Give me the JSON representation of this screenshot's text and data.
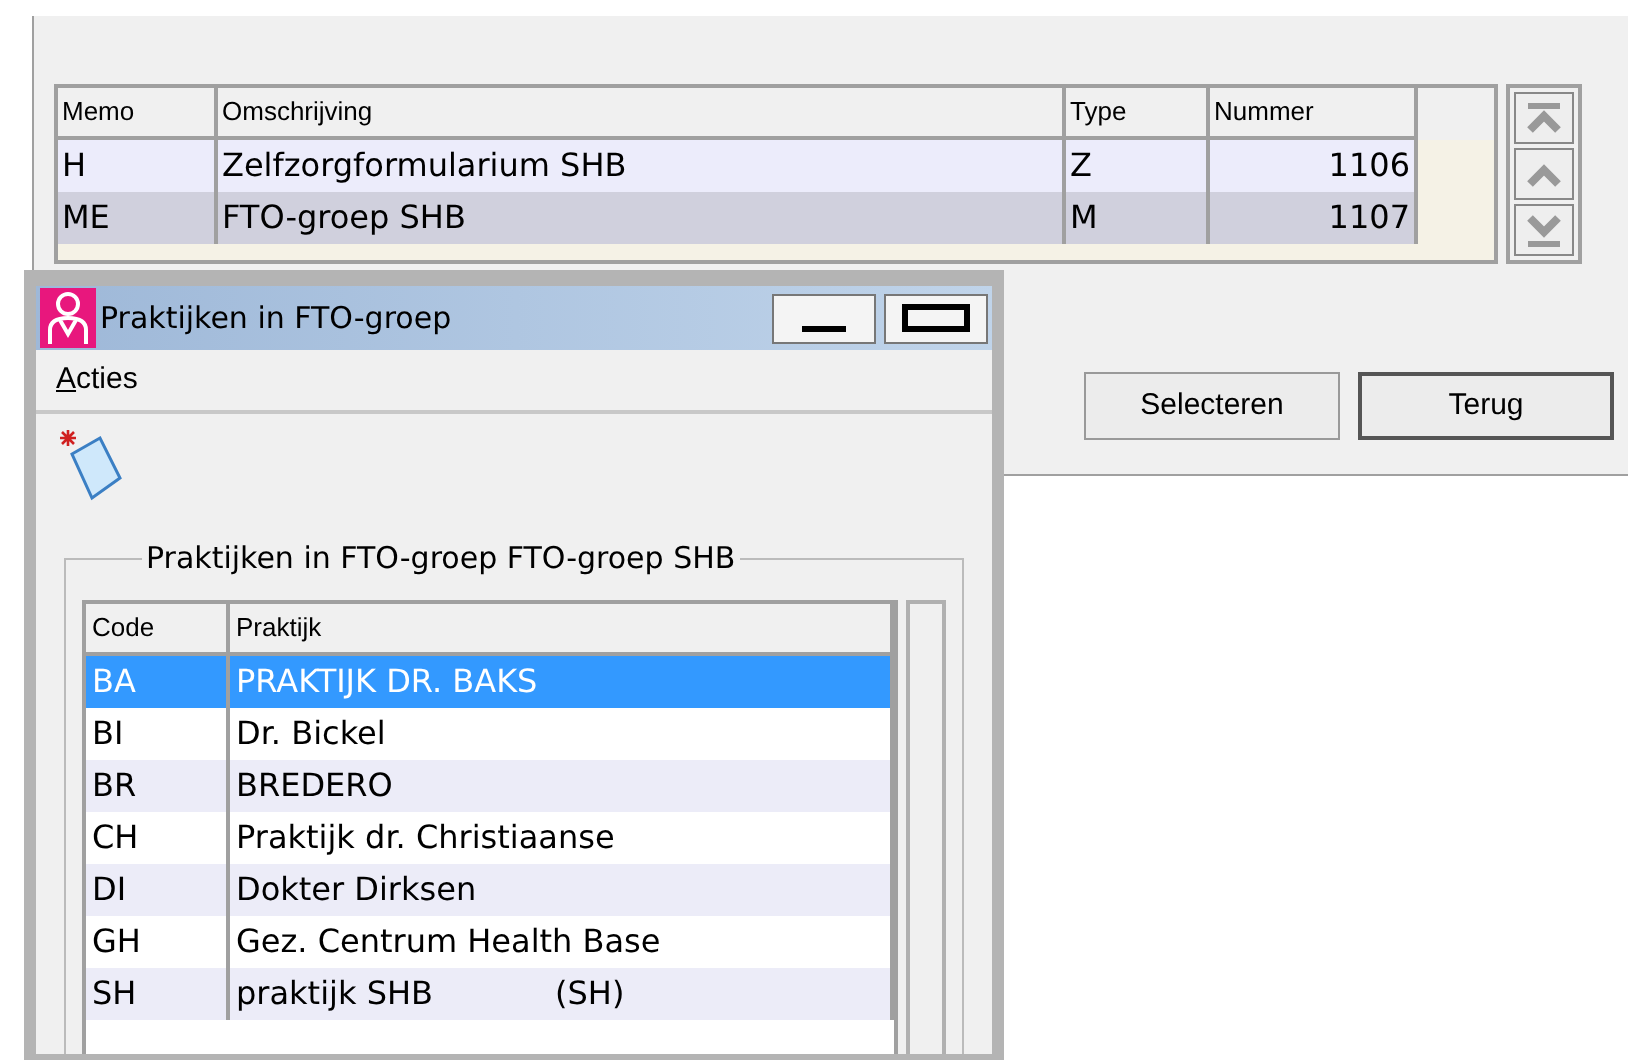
{
  "main_table": {
    "columns": [
      "Memo",
      "Omschrijving",
      "Type",
      "Nummer"
    ],
    "rows": [
      {
        "memo": "H",
        "omschrijving": "Zelfzorgformularium SHB",
        "type": "Z",
        "nummer": "1106",
        "selected": false
      },
      {
        "memo": "ME",
        "omschrijving": "FTO-groep SHB",
        "type": "M",
        "nummer": "1107",
        "selected": true
      }
    ]
  },
  "buttons": [
    "Selecteren",
    "Terug"
  ],
  "dialog": {
    "title": "Praktijken in FTO-groep",
    "menu": [
      "Acties"
    ],
    "group_title": "Praktijken in FTO-groep FTO-groep SHB",
    "table": {
      "columns": [
        "Code",
        "Praktijk"
      ],
      "rows": [
        {
          "code": "BA",
          "praktijk": "PRAKTIJK DR. BAKS",
          "selected": true
        },
        {
          "code": "BI",
          "praktijk": "Dr. Bickel",
          "selected": false
        },
        {
          "code": "BR",
          "praktijk": "BREDERO",
          "selected": false
        },
        {
          "code": "CH",
          "praktijk": "Praktijk dr. Christiaanse",
          "selected": false
        },
        {
          "code": "DI",
          "praktijk": "Dokter Dirksen",
          "selected": false
        },
        {
          "code": "GH",
          "praktijk": "Gez. Centrum Health Base",
          "selected": false
        },
        {
          "code": "SH",
          "praktijk": "praktijk SHB            (SH)",
          "selected": false
        }
      ]
    }
  }
}
